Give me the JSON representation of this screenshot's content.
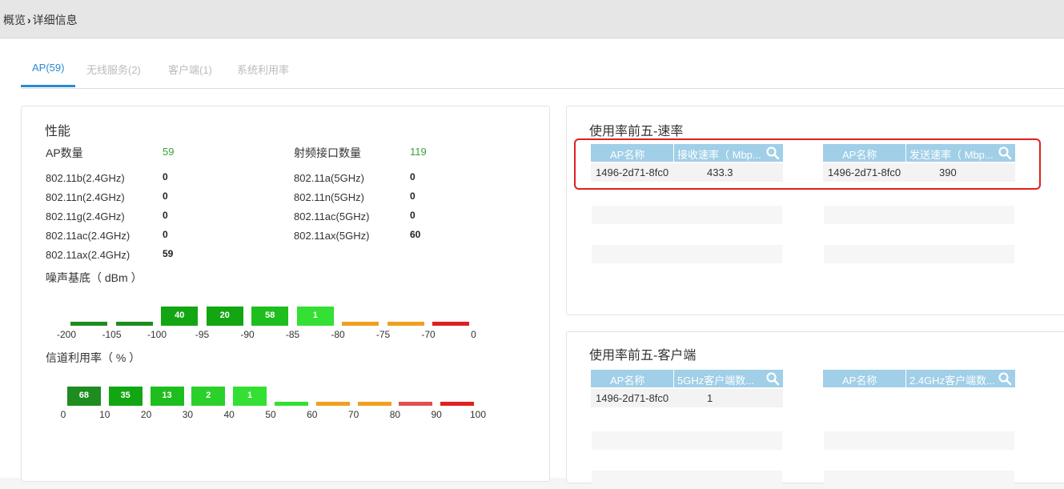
{
  "breadcrumb": {
    "root": "概览",
    "separator": "›",
    "current": "详细信息"
  },
  "tabs": [
    {
      "label": "AP(59)",
      "active": true
    },
    {
      "label": "无线服务(2)",
      "active": false
    },
    {
      "label": "客户端(1)",
      "active": false
    },
    {
      "label": "系统利用率",
      "active": false
    }
  ],
  "performance": {
    "title": "性能",
    "ap_count_label": "AP数量",
    "ap_count": "59",
    "radio_count_label": "射频接口数量",
    "radio_count": "119",
    "left_items": [
      {
        "label": "802.11b(2.4GHz)",
        "value": "0"
      },
      {
        "label": "802.11n(2.4GHz)",
        "value": "0"
      },
      {
        "label": "802.11g(2.4GHz)",
        "value": "0"
      },
      {
        "label": "802.11ac(2.4GHz)",
        "value": "0"
      },
      {
        "label": "802.11ax(2.4GHz)",
        "value": "59"
      }
    ],
    "right_items": [
      {
        "label": "802.11a(5GHz)",
        "value": "0"
      },
      {
        "label": "802.11n(5GHz)",
        "value": "0"
      },
      {
        "label": "802.11ac(5GHz)",
        "value": "0"
      },
      {
        "label": "802.11ax(5GHz)",
        "value": "60"
      }
    ],
    "noise": {
      "title": "噪声基底（ dBm ）",
      "ticks": [
        "-200",
        "-105",
        "-100",
        "-95",
        "-90",
        "-85",
        "-80",
        "-75",
        "-70",
        "0"
      ],
      "bins": [
        {
          "count": "",
          "color": "#1e8c1e"
        },
        {
          "count": "",
          "color": "#1e8c1e"
        },
        {
          "count": "40",
          "color": "#12a612"
        },
        {
          "count": "20",
          "color": "#12a612"
        },
        {
          "count": "58",
          "color": "#1ebe1e"
        },
        {
          "count": "1",
          "color": "#33e033"
        },
        {
          "count": "",
          "color": "#f0a020"
        },
        {
          "count": "",
          "color": "#f0a020"
        },
        {
          "count": "",
          "color": "#e02020"
        }
      ]
    },
    "channel": {
      "title": "信道利用率（ % ）",
      "ticks": [
        "0",
        "10",
        "20",
        "30",
        "40",
        "50",
        "60",
        "70",
        "80",
        "90",
        "100"
      ],
      "bins": [
        {
          "count": "68",
          "color": "#1e8c1e"
        },
        {
          "count": "35",
          "color": "#12a612"
        },
        {
          "count": "13",
          "color": "#1ebe1e"
        },
        {
          "count": "2",
          "color": "#2bd02b"
        },
        {
          "count": "1",
          "color": "#33e033"
        },
        {
          "count": "",
          "color": "#33e033"
        },
        {
          "count": "",
          "color": "#f0a020"
        },
        {
          "count": "",
          "color": "#f0a020"
        },
        {
          "count": "",
          "color": "#e05050"
        },
        {
          "count": "",
          "color": "#e02020"
        }
      ]
    }
  },
  "top5_rate": {
    "title": "使用率前五-速率",
    "rx": {
      "col1": "AP名称",
      "col2": "接收速率（ Mbp...",
      "rows": [
        {
          "name": "1496-2d71-8fc0",
          "value": "433.3"
        }
      ]
    },
    "tx": {
      "col1": "AP名称",
      "col2": "发送速率（ Mbp...",
      "rows": [
        {
          "name": "1496-2d71-8fc0",
          "value": "390"
        }
      ]
    }
  },
  "top5_client": {
    "title": "使用率前五-客户端",
    "g5": {
      "col1": "AP名称",
      "col2": "5GHz客户端数...",
      "rows": [
        {
          "name": "1496-2d71-8fc0",
          "value": "1"
        }
      ]
    },
    "g24": {
      "col1": "AP名称",
      "col2": "2.4GHz客户端数...",
      "rows": []
    }
  },
  "colors": {
    "accent": "#2a8bd0",
    "table_header": "#a0cfe7",
    "highlight": "#e02020"
  }
}
